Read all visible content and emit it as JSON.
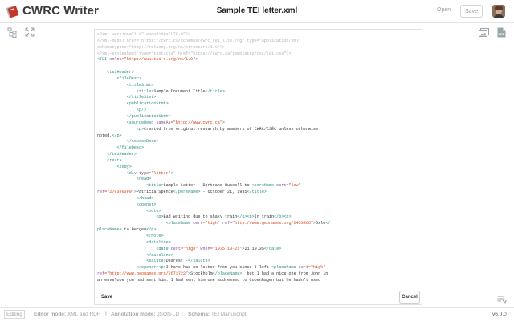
{
  "header": {
    "app_title": "CWRC Writer",
    "doc_title": "Sample TEI letter.xml",
    "open_label": "Open",
    "save_label": "Save"
  },
  "left_toolbar": {
    "icons": [
      "structure-tree-icon",
      "resize-arrows-icon"
    ]
  },
  "right_toolbar": {
    "icons": [
      "image-icon",
      "pdf-icon"
    ]
  },
  "editor": {
    "xml_lines": [
      [
        {
          "t": "<?xml version=\"1.0\" encoding=\"UTF-8\"?>",
          "c": "proc"
        }
      ],
      [
        {
          "t": "<?xml-model href=\"https://cwrc.ca/schemas/cwrc_tei_lite.rng\" type=\"application/xml\"",
          "c": "proc"
        }
      ],
      [
        {
          "t": "schematypens=\"http://relaxng.org/ns/structure/1.0\"?>",
          "c": "proc"
        }
      ],
      [
        {
          "t": "<?xml-stylesheet type=\"text/css\" href=\"https://cwrc.ca/templates/css/tei.css\"?>",
          "c": "proc"
        }
      ],
      [
        {
          "t": "<TEI ",
          "c": "tag"
        },
        {
          "t": "xmlns",
          "c": "attr"
        },
        {
          "t": "=\"http://www.tei-c.org/ns/1.0\"",
          "c": "val"
        },
        {
          "t": ">",
          "c": "tag"
        }
      ],
      [
        {
          "t": "",
          "c": "text"
        }
      ],
      [
        {
          "t": "    <teiHeader>",
          "c": "tag"
        }
      ],
      [
        {
          "t": "        <fileDesc>",
          "c": "tag"
        }
      ],
      [
        {
          "t": "            <titleStmt>",
          "c": "tag"
        }
      ],
      [
        {
          "t": "                <title>",
          "c": "tag"
        },
        {
          "t": "Sample Document Title",
          "c": "text"
        },
        {
          "t": "</title>",
          "c": "tag"
        }
      ],
      [
        {
          "t": "            </titleStmt>",
          "c": "tag"
        }
      ],
      [
        {
          "t": "            <publicationStmt>",
          "c": "tag"
        }
      ],
      [
        {
          "t": "                <p/>",
          "c": "tag"
        }
      ],
      [
        {
          "t": "            </publicationStmt>",
          "c": "tag"
        }
      ],
      [
        {
          "t": "            <sourceDesc ",
          "c": "tag"
        },
        {
          "t": "sameAs",
          "c": "attr"
        },
        {
          "t": "=\"http://www.cwrc.ca\"",
          "c": "val"
        },
        {
          "t": ">",
          "c": "tag"
        }
      ],
      [
        {
          "t": "                <p>",
          "c": "tag"
        },
        {
          "t": "Created from original research by members of CWRC/CSÉC unless otherwise",
          "c": "text"
        }
      ],
      [
        {
          "t": "noted.",
          "c": "text"
        },
        {
          "t": "</p>",
          "c": "tag"
        }
      ],
      [
        {
          "t": "            </sourceDesc>",
          "c": "tag"
        }
      ],
      [
        {
          "t": "        </fileDesc>",
          "c": "tag"
        }
      ],
      [
        {
          "t": "    </teiHeader>",
          "c": "tag"
        }
      ],
      [
        {
          "t": "    <text>",
          "c": "tag"
        }
      ],
      [
        {
          "t": "        <body>",
          "c": "tag"
        }
      ],
      [
        {
          "t": "            <div ",
          "c": "tag"
        },
        {
          "t": "type",
          "c": "attr"
        },
        {
          "t": "=\"letter\"",
          "c": "val"
        },
        {
          "t": ">",
          "c": "tag"
        }
      ],
      [
        {
          "t": "                <head>",
          "c": "tag"
        }
      ],
      [
        {
          "t": "                    <title>",
          "c": "tag"
        },
        {
          "t": "Sample Letter - Bertrand Russell to ",
          "c": "text"
        },
        {
          "t": "<persName ",
          "c": "tag"
        },
        {
          "t": "cert",
          "c": "attr"
        },
        {
          "t": "=\"low\"",
          "c": "val"
        }
      ],
      [
        {
          "t": "ref",
          "c": "attr"
        },
        {
          "t": "=\"279399399\"",
          "c": "val"
        },
        {
          "t": ">",
          "c": "tag"
        },
        {
          "t": "Patricia Spence",
          "c": "text"
        },
        {
          "t": "</persName>",
          "c": "tag"
        },
        {
          "t": " - October 21, 1935",
          "c": "text"
        },
        {
          "t": "</title>",
          "c": "tag"
        }
      ],
      [
        {
          "t": "                </head>",
          "c": "tag"
        }
      ],
      [
        {
          "t": "                <opener>",
          "c": "tag"
        }
      ],
      [
        {
          "t": "                    <note>",
          "c": "tag"
        }
      ],
      [
        {
          "t": "                        <p>",
          "c": "tag"
        },
        {
          "t": "Bad writing due to shaky train",
          "c": "text"
        },
        {
          "t": "</p><p>",
          "c": "tag"
        },
        {
          "t": "In train",
          "c": "text"
        },
        {
          "t": "</p><p>",
          "c": "tag"
        }
      ],
      [
        {
          "t": "                            <placeName ",
          "c": "tag"
        },
        {
          "t": "cert",
          "c": "attr"
        },
        {
          "t": "=\"high\" ",
          "c": "val"
        },
        {
          "t": "ref",
          "c": "attr"
        },
        {
          "t": "=\"http://www.geonames.org/6453366\"",
          "c": "val"
        },
        {
          "t": ">",
          "c": "tag"
        },
        {
          "t": "Oslo",
          "c": "text"
        },
        {
          "t": "</",
          "c": "tag"
        }
      ],
      [
        {
          "t": "placeName>",
          "c": "tag"
        },
        {
          "t": " to Bergen",
          "c": "text"
        },
        {
          "t": "</p>",
          "c": "tag"
        }
      ],
      [
        {
          "t": "                    </note>",
          "c": "tag"
        }
      ],
      [
        {
          "t": "                    <dateline>",
          "c": "tag"
        }
      ],
      [
        {
          "t": "                        <date ",
          "c": "tag"
        },
        {
          "t": "cert",
          "c": "attr"
        },
        {
          "t": "=\"high\" ",
          "c": "val"
        },
        {
          "t": "when",
          "c": "attr"
        },
        {
          "t": "=\"1935-10-21\"",
          "c": "val"
        },
        {
          "t": ">",
          "c": "tag"
        },
        {
          "t": "21.10.35",
          "c": "text"
        },
        {
          "t": "</date>",
          "c": "tag"
        }
      ],
      [
        {
          "t": "                    </dateline>",
          "c": "tag"
        }
      ],
      [
        {
          "t": "                    <salute>",
          "c": "tag"
        },
        {
          "t": "Dearest -",
          "c": "text"
        },
        {
          "t": "</salute>",
          "c": "tag"
        }
      ],
      [
        {
          "t": "                </opener>",
          "c": "tag"
        },
        {
          "t": "<p>",
          "c": "tag"
        },
        {
          "t": "I have had no letter from you since I left ",
          "c": "text"
        },
        {
          "t": "<placeName ",
          "c": "tag"
        },
        {
          "t": "cert",
          "c": "attr"
        },
        {
          "t": "=\"high\"",
          "c": "val"
        }
      ],
      [
        {
          "t": "ref",
          "c": "attr"
        },
        {
          "t": "=\"http://www.geonames.org/2673722\"",
          "c": "val"
        },
        {
          "t": ">",
          "c": "tag"
        },
        {
          "t": "Stockholm",
          "c": "text"
        },
        {
          "t": "</placeName>",
          "c": "tag"
        },
        {
          "t": ", but I had a nice one from John in",
          "c": "text"
        }
      ],
      [
        {
          "t": "an envelope you had sent him. I had sent him one addressed to Copenhagen but he hadn't used",
          "c": "text"
        }
      ]
    ],
    "save_label": "Save",
    "cancel_label": "Cancel"
  },
  "statusbar": {
    "editing_label": "Editing",
    "editor_mode_label": "Editor mode:",
    "editor_mode_value": "XML and RDF",
    "annotation_mode_label": "Annotation mode:",
    "annotation_mode_value": "JSON-LD",
    "schema_label": "Schema:",
    "schema_value": "TEI Manuscript",
    "separator": "|",
    "version": "v6.0.0"
  },
  "colors": {
    "tag": "#2a8a86",
    "attr": "#7b4ba0",
    "value": "#d7441f",
    "processing_instruction": "#b4b4b4",
    "logo_red": "#c0392b"
  }
}
